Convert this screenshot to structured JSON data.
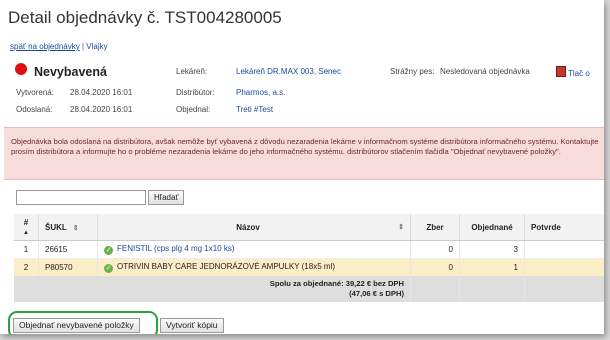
{
  "header": {
    "title": "Detail objednávky č. TST004280005"
  },
  "nav": {
    "back": "späť na objednávky",
    "separator": "|",
    "flags": "Vlajky"
  },
  "order": {
    "status": "Nevybavená",
    "status_color": "#dd1111",
    "created_label": "Vytvorená:",
    "created": "28.04.2020 16:01",
    "sent_label": "Odoslaná:",
    "sent": "28.04.2020 16:01",
    "pharmacy_label": "Lekáreň:",
    "pharmacy": "Lekáreň DR.MAX 003, Senec",
    "distributor_label": "Distribútor:",
    "distributor": "Pharmos, a.s.",
    "orderer_label": "Objednal:",
    "orderer": "Treti #Test",
    "watchdog_label": "Strážny pes:",
    "watchdog": "Nesledovaná objednávka",
    "print_label": "Tlač o"
  },
  "alert": {
    "text": "Objednávka bola odoslaná na distribútora, avšak nemôže byť vybavená z dôvodu nezaradenia lekárne v informačnom systéme distribútora informačného systému. Kontaktujte prosím distribútora a informujte ho o probléme nezaradenia lekárne do jeho informačného systému. distribútorov stlačením tlačidla \"Objednať nevybavené položky\"."
  },
  "search": {
    "value": "",
    "button": "Hľadať"
  },
  "table": {
    "headers": {
      "index": "#",
      "sukl": "ŠUKL",
      "name": "Názov",
      "zber": "Zber",
      "ordered": "Objednané",
      "confirmed": "Potvrde"
    },
    "rows": [
      {
        "index": "1",
        "sukl": "26615",
        "name": "FENISTIL (cps plg 4 mg 1x10 ks)",
        "zber": "0",
        "ordered": "3",
        "confirmed": ""
      },
      {
        "index": "2",
        "sukl": "P80570",
        "name": "OTRIVIN BABY CARE JEDNORÁZOVÉ AMPULKY (18x5 ml)",
        "zber": "0",
        "ordered": "1",
        "confirmed": ""
      }
    ],
    "total_line1": "Spolu za objednané: 39,22 € bez DPH",
    "total_line2": "(47,06 € s DPH)"
  },
  "actions": {
    "order_missing": "Objednať nevybavené položky",
    "create_copy": "Vytvoriť kópiu"
  }
}
